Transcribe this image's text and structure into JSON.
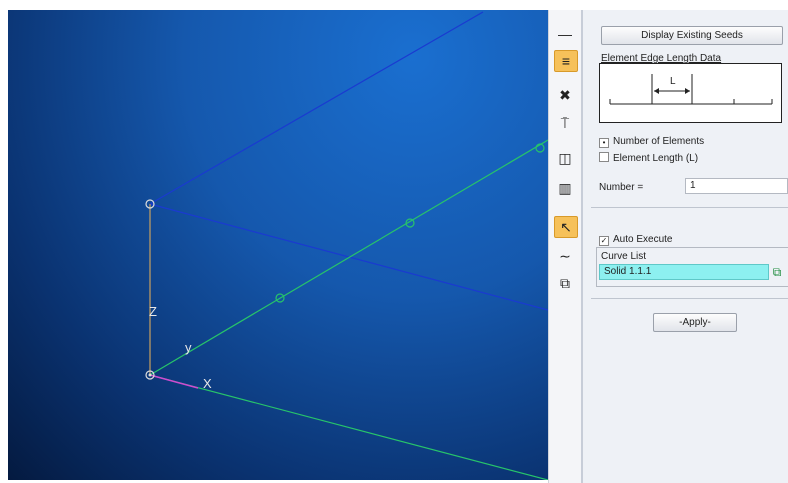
{
  "viewport": {
    "axis_labels": {
      "z": "Z",
      "y": "y",
      "x": "X"
    }
  },
  "toolbar": {
    "tools": [
      {
        "icon": "minus-icon",
        "glyph": "—",
        "active": false
      },
      {
        "icon": "equals-icon",
        "glyph": "≡",
        "active": true
      },
      {
        "icon": "tools-icon",
        "glyph": "✖",
        "active": false
      },
      {
        "icon": "seed-icon",
        "glyph": "⍑",
        "active": false
      },
      {
        "icon": "split-icon",
        "glyph": "◫",
        "active": false
      },
      {
        "icon": "bar-icon",
        "glyph": "▥",
        "active": false
      },
      {
        "icon": "cursor-icon",
        "glyph": "↖",
        "active": true
      },
      {
        "icon": "curve-icon",
        "glyph": "∼",
        "active": false
      },
      {
        "icon": "copy-icon",
        "glyph": "⧉",
        "active": false
      }
    ]
  },
  "panel": {
    "display_button": "Display Existing Seeds",
    "edge_data_title": "Element Edge Length Data",
    "diagram_label": "L",
    "option_number": "Number of Elements",
    "option_length": "Element Length (L)",
    "number_label": "Number =",
    "number_value": "1",
    "auto_execute": "Auto Execute",
    "curve_list_label": "Curve List",
    "curve_list_value": "Solid 1.1.1",
    "apply_button": "-Apply-"
  },
  "colors": {
    "green_line": "#27c46a",
    "blue_line": "#1a3ad0",
    "highlight": "#8df0f0",
    "active_tool": "#f6c15a"
  }
}
